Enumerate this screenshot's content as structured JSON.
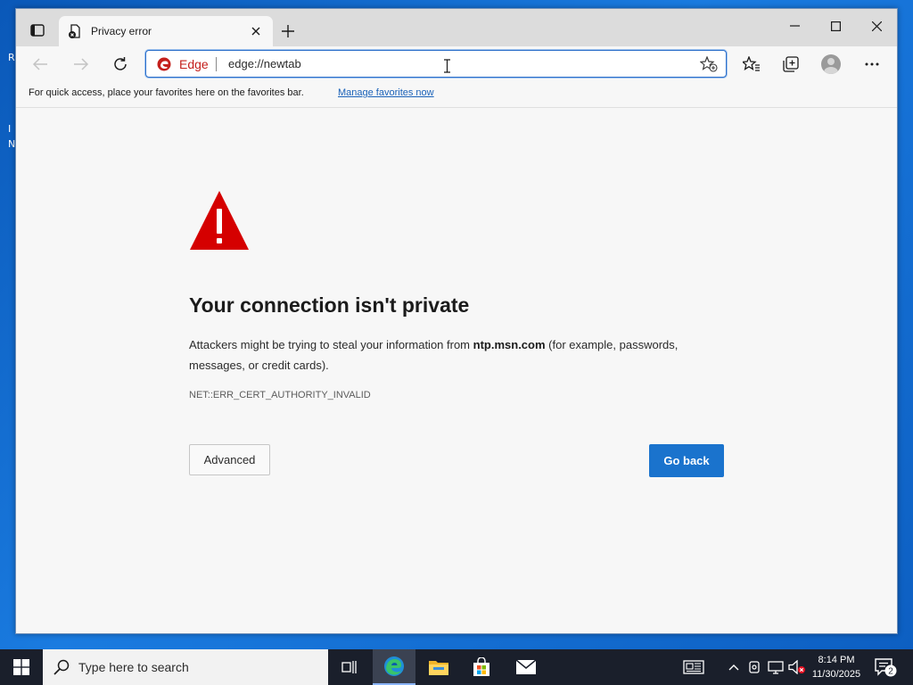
{
  "desktop": {
    "labels": [
      "R",
      "I",
      "N"
    ]
  },
  "browser": {
    "tab": {
      "title": "Privacy error"
    },
    "address": {
      "site_name": "Edge",
      "url": "edge://newtab"
    },
    "favorites_bar": {
      "message": "For quick access, place your favorites here on the favorites bar.",
      "link": "Manage favorites now"
    },
    "error": {
      "title": "Your connection isn't private",
      "desc_before": "Attackers might be trying to steal your information from ",
      "host": "ntp.msn.com",
      "desc_after": " (for example, passwords, messages, or credit cards).",
      "code": "NET::ERR_CERT_AUTHORITY_INVALID",
      "advanced_label": "Advanced",
      "goback_label": "Go back"
    }
  },
  "taskbar": {
    "search_placeholder": "Type here to search",
    "time": "8:14 PM",
    "date": "11/30/2025",
    "notification_count": "2"
  },
  "colors": {
    "accent": "#1a73cd",
    "error_red": "#d50000",
    "taskbar": "#1a1f2b"
  },
  "icons": [
    "tab-actions-icon",
    "tab-favicon-icon",
    "close-icon",
    "plus-icon",
    "minimize-icon",
    "maximize-icon",
    "back-icon",
    "forward-icon",
    "refresh-icon",
    "edge-logo-icon",
    "add-favorite-icon",
    "favorites-icon",
    "collections-icon",
    "profile-icon",
    "more-icon",
    "warning-icon",
    "windows-logo-icon",
    "search-icon",
    "task-view-icon",
    "edge-icon",
    "file-explorer-icon",
    "store-icon",
    "mail-icon",
    "chevron-up-icon",
    "network-icon",
    "volume-muted-icon",
    "notification-icon"
  ]
}
